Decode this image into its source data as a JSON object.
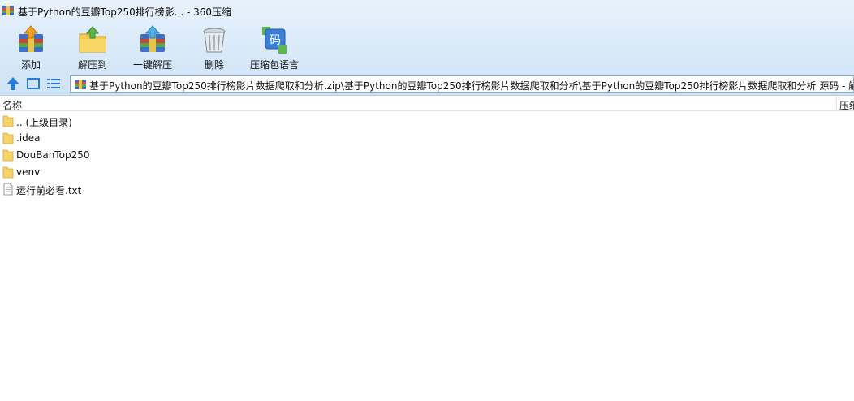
{
  "window": {
    "title": "基于Python的豆瓣Top250排行榜影... - 360压缩"
  },
  "toolbar": {
    "buttons": [
      {
        "label": "添加",
        "icon": "add-archive-icon"
      },
      {
        "label": "解压到",
        "icon": "extract-to-icon"
      },
      {
        "label": "一键解压",
        "icon": "one-click-extract-icon"
      },
      {
        "label": "删除",
        "icon": "delete-trash-icon"
      },
      {
        "label": "压缩包语言",
        "icon": "archive-language-icon"
      }
    ],
    "language_glyph": "码"
  },
  "address": {
    "path": "基于Python的豆瓣Top250排行榜影片数据爬取和分析.zip\\基于Python的豆瓣Top250排行榜影片数据爬取和分析\\基于Python的豆瓣Top250排行榜影片数据爬取和分析 源码 - 解"
  },
  "columns": {
    "name": "名称",
    "compressed": "压缩"
  },
  "files": [
    {
      "name": ".. (上级目录)",
      "type": "folder"
    },
    {
      "name": ".idea",
      "type": "folder"
    },
    {
      "name": "DouBanTop250",
      "type": "folder"
    },
    {
      "name": "venv",
      "type": "folder"
    },
    {
      "name": "运行前必看.txt",
      "type": "text-file"
    }
  ],
  "colors": {
    "chrome_top": "#e9f2fb",
    "chrome_bottom": "#cfe3f6",
    "folder": "#f7d36b",
    "accent_blue": "#2a79d6"
  }
}
